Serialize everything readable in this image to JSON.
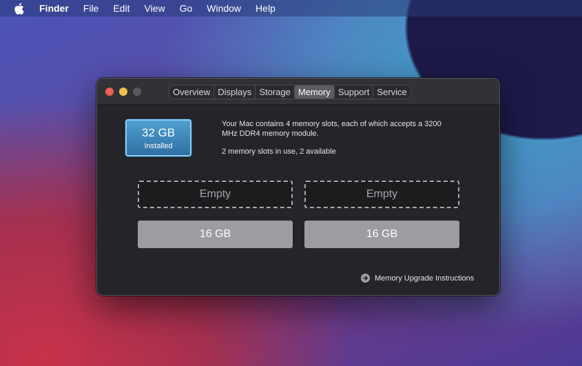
{
  "menubar": {
    "apple_icon": "apple-logo-icon",
    "app_name": "Finder",
    "items": [
      "File",
      "Edit",
      "View",
      "Go",
      "Window",
      "Help"
    ]
  },
  "window": {
    "tabs": [
      {
        "label": "Overview",
        "active": false
      },
      {
        "label": "Displays",
        "active": false
      },
      {
        "label": "Storage",
        "active": false
      },
      {
        "label": "Memory",
        "active": true
      },
      {
        "label": "Support",
        "active": false
      },
      {
        "label": "Service",
        "active": false
      }
    ],
    "summary": {
      "size": "32 GB",
      "label": "Installed"
    },
    "info": {
      "description": "Your Mac contains 4 memory slots, each of which accepts a 3200 MHz DDR4 memory module.",
      "usage": "2 memory slots in use, 2 available"
    },
    "slots": [
      {
        "label": "Empty",
        "state": "empty"
      },
      {
        "label": "Empty",
        "state": "empty"
      },
      {
        "label": "16 GB",
        "state": "filled"
      },
      {
        "label": "16 GB",
        "state": "filled"
      }
    ],
    "upgrade_link": {
      "icon": "arrow-right-circle-icon",
      "label": "Memory Upgrade Instructions"
    }
  },
  "colors": {
    "window_bg": "#242429",
    "badge_blue": "#3b84ba",
    "slot_filled": "#9c9ca1",
    "close": "#ee5f57",
    "minimize": "#f4be4f"
  }
}
